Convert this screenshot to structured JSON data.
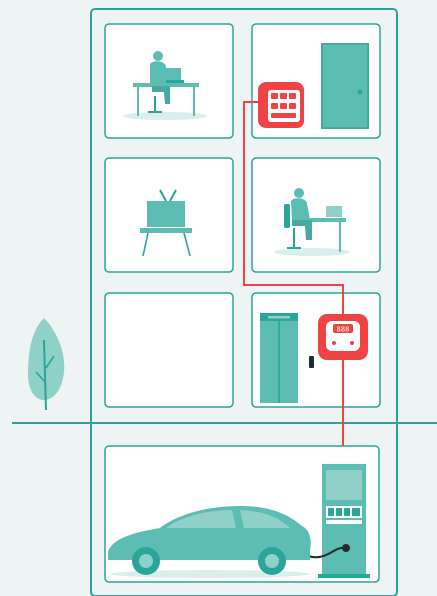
{
  "title": "",
  "colors": {
    "background": "#eef4f4",
    "teal": "#2aa59a",
    "teal_fill": "#5bbdb3",
    "teal_light": "#8fd0c8",
    "red": "#ef4444",
    "white": "#ffffff"
  },
  "devices": {
    "meter_display": "888"
  },
  "rooms": [
    {
      "name": "office-with-person",
      "icon": "person-at-desk-icon"
    },
    {
      "name": "room-with-door-and-breaker-panel",
      "icon": "door-icon"
    },
    {
      "name": "living-room",
      "icon": "tv-icon"
    },
    {
      "name": "office-with-laptop",
      "icon": "person-with-laptop-icon"
    },
    {
      "name": "empty-room",
      "icon": ""
    },
    {
      "name": "elevator-room-with-meter",
      "icon": "elevator-icon"
    }
  ],
  "garage": {
    "icon": "electric-car-icon",
    "charger_icon": "ev-charger-icon"
  }
}
